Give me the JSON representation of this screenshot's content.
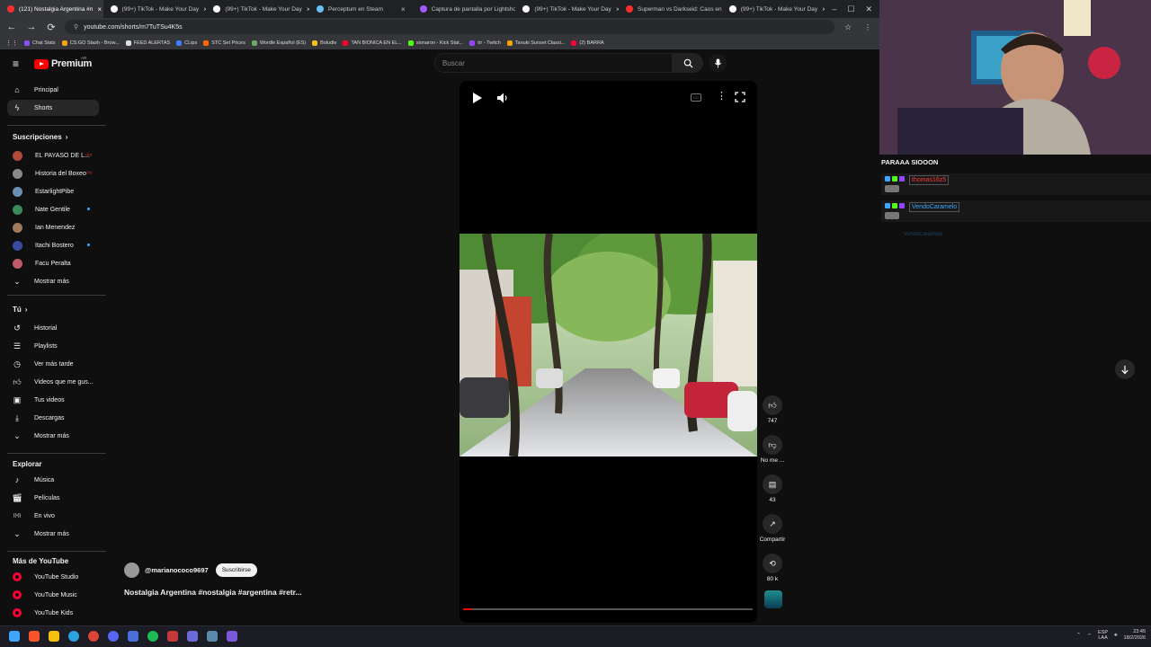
{
  "browser": {
    "tabs": [
      {
        "title": "(121) Nostalgia Argentina #n",
        "active": true,
        "fav_color": "#ff2d2d"
      },
      {
        "title": "(99+) TikTok - Make Your Day",
        "active": false,
        "fav_color": "#ffffff"
      },
      {
        "title": "(99+) TikTok - Make Your Day",
        "active": false,
        "fav_color": "#ffffff"
      },
      {
        "title": "Perceptum en Steam",
        "active": false,
        "fav_color": "#66c0f4"
      },
      {
        "title": "Captura de pantalla por Lightshot",
        "active": false,
        "fav_color": "#a259ff"
      },
      {
        "title": "(99+) TikTok - Make Your Day",
        "active": false,
        "fav_color": "#ffffff"
      },
      {
        "title": "Superman vs Darkseid: Caos en la c",
        "active": false,
        "fav_color": "#ff2d2d"
      },
      {
        "title": "(99+) TikTok - Make Your Day",
        "active": false,
        "fav_color": "#ffffff"
      }
    ],
    "url": "youtube.com/shorts/m7TuTSu4K5s",
    "bookmarks": [
      {
        "label": "Chat Stats",
        "color": "#8a4dff"
      },
      {
        "label": "CS:GO Stash - Brow...",
        "color": "#f4a300"
      },
      {
        "label": "FEED ALERTAS",
        "color": "#dddddd"
      },
      {
        "label": "CLips",
        "color": "#3d7bff"
      },
      {
        "label": "STC Set Prices",
        "color": "#ff6a00"
      },
      {
        "label": "Wordle Español (ES)",
        "color": "#6aaa64"
      },
      {
        "label": "Boludle",
        "color": "#f4c20d"
      },
      {
        "label": "TAN BIONICA EN EL...",
        "color": "#ff0033"
      },
      {
        "label": "sionaron - Kick Stat...",
        "color": "#53fc18"
      },
      {
        "label": "trr - Twitch",
        "color": "#9146ff"
      },
      {
        "label": "Tanuki Sunset Classi...",
        "color": "#f4a300"
      },
      {
        "label": "(2) BARRA",
        "color": "#ff0033"
      }
    ]
  },
  "youtube": {
    "logo_text": "Premium",
    "country_code": "AR",
    "search_placeholder": "Buscar",
    "sidebar": {
      "main": [
        {
          "label": "Principal",
          "icon": "home-icon"
        },
        {
          "label": "Shorts",
          "icon": "shorts-icon",
          "active": true
        }
      ],
      "subscriptions_header": "Suscripciones",
      "subscriptions": [
        {
          "label": "EL PAYASO DE L...",
          "live": true,
          "avatar": "#b04a3a"
        },
        {
          "label": "Historia del Boxeo",
          "live": true,
          "avatar": "#8a8a8a"
        },
        {
          "label": "EstarlightPibe",
          "live": false,
          "avatar": "#6b8fb0"
        },
        {
          "label": "Nate Gentile",
          "new": true,
          "avatar": "#3a8a5a"
        },
        {
          "label": "Ian Menendez",
          "live": false,
          "avatar": "#a07a5a"
        },
        {
          "label": "Itachi Bostero",
          "new": true,
          "avatar": "#3a4aa0"
        },
        {
          "label": "Facu Peralta",
          "live": false,
          "avatar": "#c05a6a"
        }
      ],
      "show_more": "Mostrar más",
      "you_header": "Tú",
      "you_items": [
        {
          "label": "Historial",
          "icon": "history-icon"
        },
        {
          "label": "Playlists",
          "icon": "playlists-icon"
        },
        {
          "label": "Ver más tarde",
          "icon": "watch-later-icon"
        },
        {
          "label": "Videos que me gus...",
          "icon": "liked-videos-icon"
        },
        {
          "label": "Tus videos",
          "icon": "your-videos-icon"
        },
        {
          "label": "Descargas",
          "icon": "downloads-icon"
        },
        {
          "label": "Mostrar más",
          "icon": "chevron-down-icon"
        }
      ],
      "explore_header": "Explorar",
      "explore_items": [
        {
          "label": "Música",
          "icon": "music-icon"
        },
        {
          "label": "Películas",
          "icon": "movies-icon"
        },
        {
          "label": "En vivo",
          "icon": "live-icon"
        },
        {
          "label": "Mostrar más",
          "icon": "chevron-down-icon"
        }
      ],
      "more_header": "Más de YouTube",
      "more_items": [
        {
          "label": "YouTube Studio"
        },
        {
          "label": "YouTube Music"
        },
        {
          "label": "YouTube Kids"
        }
      ]
    },
    "short": {
      "channel_handle": "@marianococo9697",
      "subscribe_label": "Suscribirse",
      "title": "Nostalgia Argentina #nostalgia #argentina #retr...",
      "progress": 0.03,
      "actions": [
        {
          "name": "like",
          "label": "747"
        },
        {
          "name": "dislike",
          "label": "No me ..."
        },
        {
          "name": "comments",
          "label": "43"
        },
        {
          "name": "share",
          "label": "Compartir"
        },
        {
          "name": "remix",
          "label": "80 k"
        }
      ]
    }
  },
  "stream_overlay": {
    "title": "PARAAA SIOOON",
    "chat": [
      {
        "user": "thomas16z5",
        "color": "#ff3b3b"
      },
      {
        "user": "VendoCaramelo",
        "color": "#3ea6ff"
      }
    ],
    "faded_chat_user": "VendoCaramelo"
  },
  "taskbar": {
    "lang": "ESP",
    "region": "LAA",
    "time": "23:45",
    "date": "18/2/2026"
  }
}
